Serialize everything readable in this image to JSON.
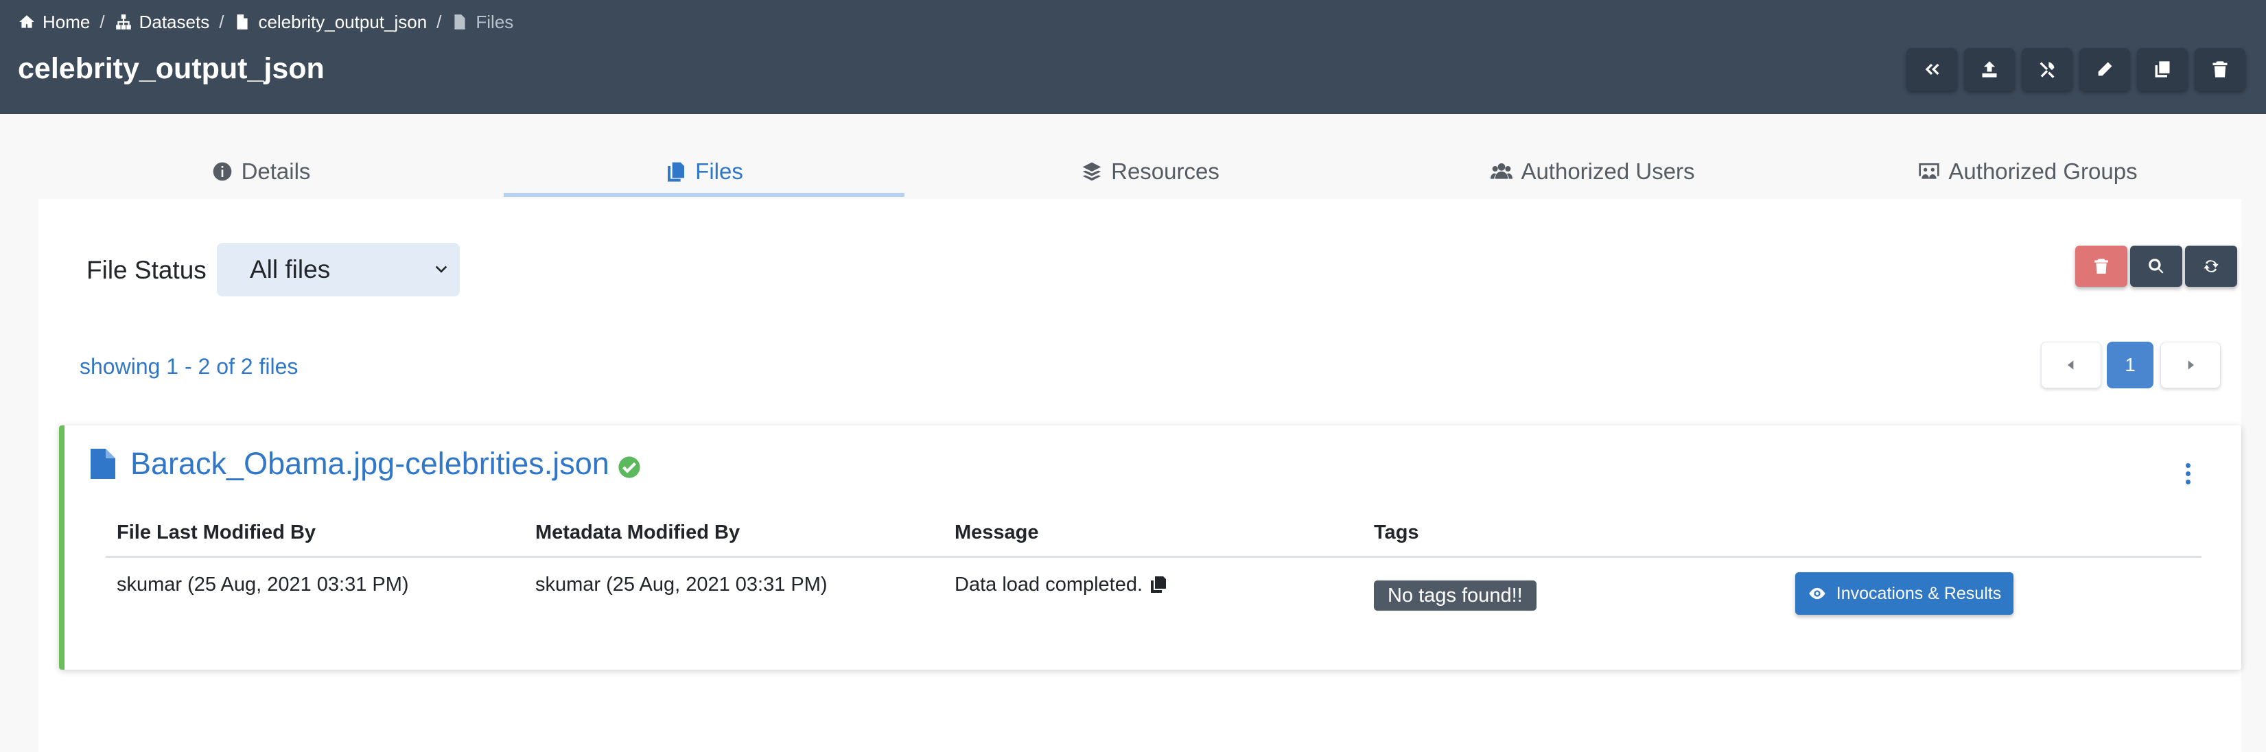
{
  "breadcrumb": {
    "items": [
      {
        "label": "Home",
        "icon": "home-icon"
      },
      {
        "label": "Datasets",
        "icon": "sitemap-icon"
      },
      {
        "label": "celebrity_output_json",
        "icon": "file-icon"
      },
      {
        "label": "Files",
        "icon": "file-icon"
      }
    ],
    "separator": "/"
  },
  "header": {
    "title": "celebrity_output_json",
    "tools": [
      "back-icon",
      "upload-icon",
      "tools-icon",
      "edit-icon",
      "copy-icon",
      "trash-icon"
    ]
  },
  "tabs": [
    {
      "label": "Details",
      "icon": "info-icon"
    },
    {
      "label": "Files",
      "icon": "files-icon",
      "active": true
    },
    {
      "label": "Resources",
      "icon": "layers-icon"
    },
    {
      "label": "Authorized Users",
      "icon": "users-icon"
    },
    {
      "label": "Authorized Groups",
      "icon": "group-icon"
    }
  ],
  "filter": {
    "label": "File Status",
    "selected": "All files"
  },
  "listing": {
    "showing": "showing 1 - 2 of 2 files",
    "current_page": "1"
  },
  "files": [
    {
      "name": "Barack_Obama.jpg-celebrities.json",
      "columns": [
        "File Last Modified By",
        "Metadata Modified By",
        "Message",
        "Tags"
      ],
      "file_modified": "skumar (25 Aug, 2021 03:31 PM)",
      "metadata_modified": "skumar (25 Aug, 2021 03:31 PM)",
      "message": "Data load completed.",
      "tags": "No tags found!!",
      "action_label": "Invocations & Results"
    }
  ],
  "colors": {
    "header_bg": "#3c4a5a",
    "accent": "#3077c9",
    "success": "#6bbf5a",
    "danger": "#e07575"
  }
}
